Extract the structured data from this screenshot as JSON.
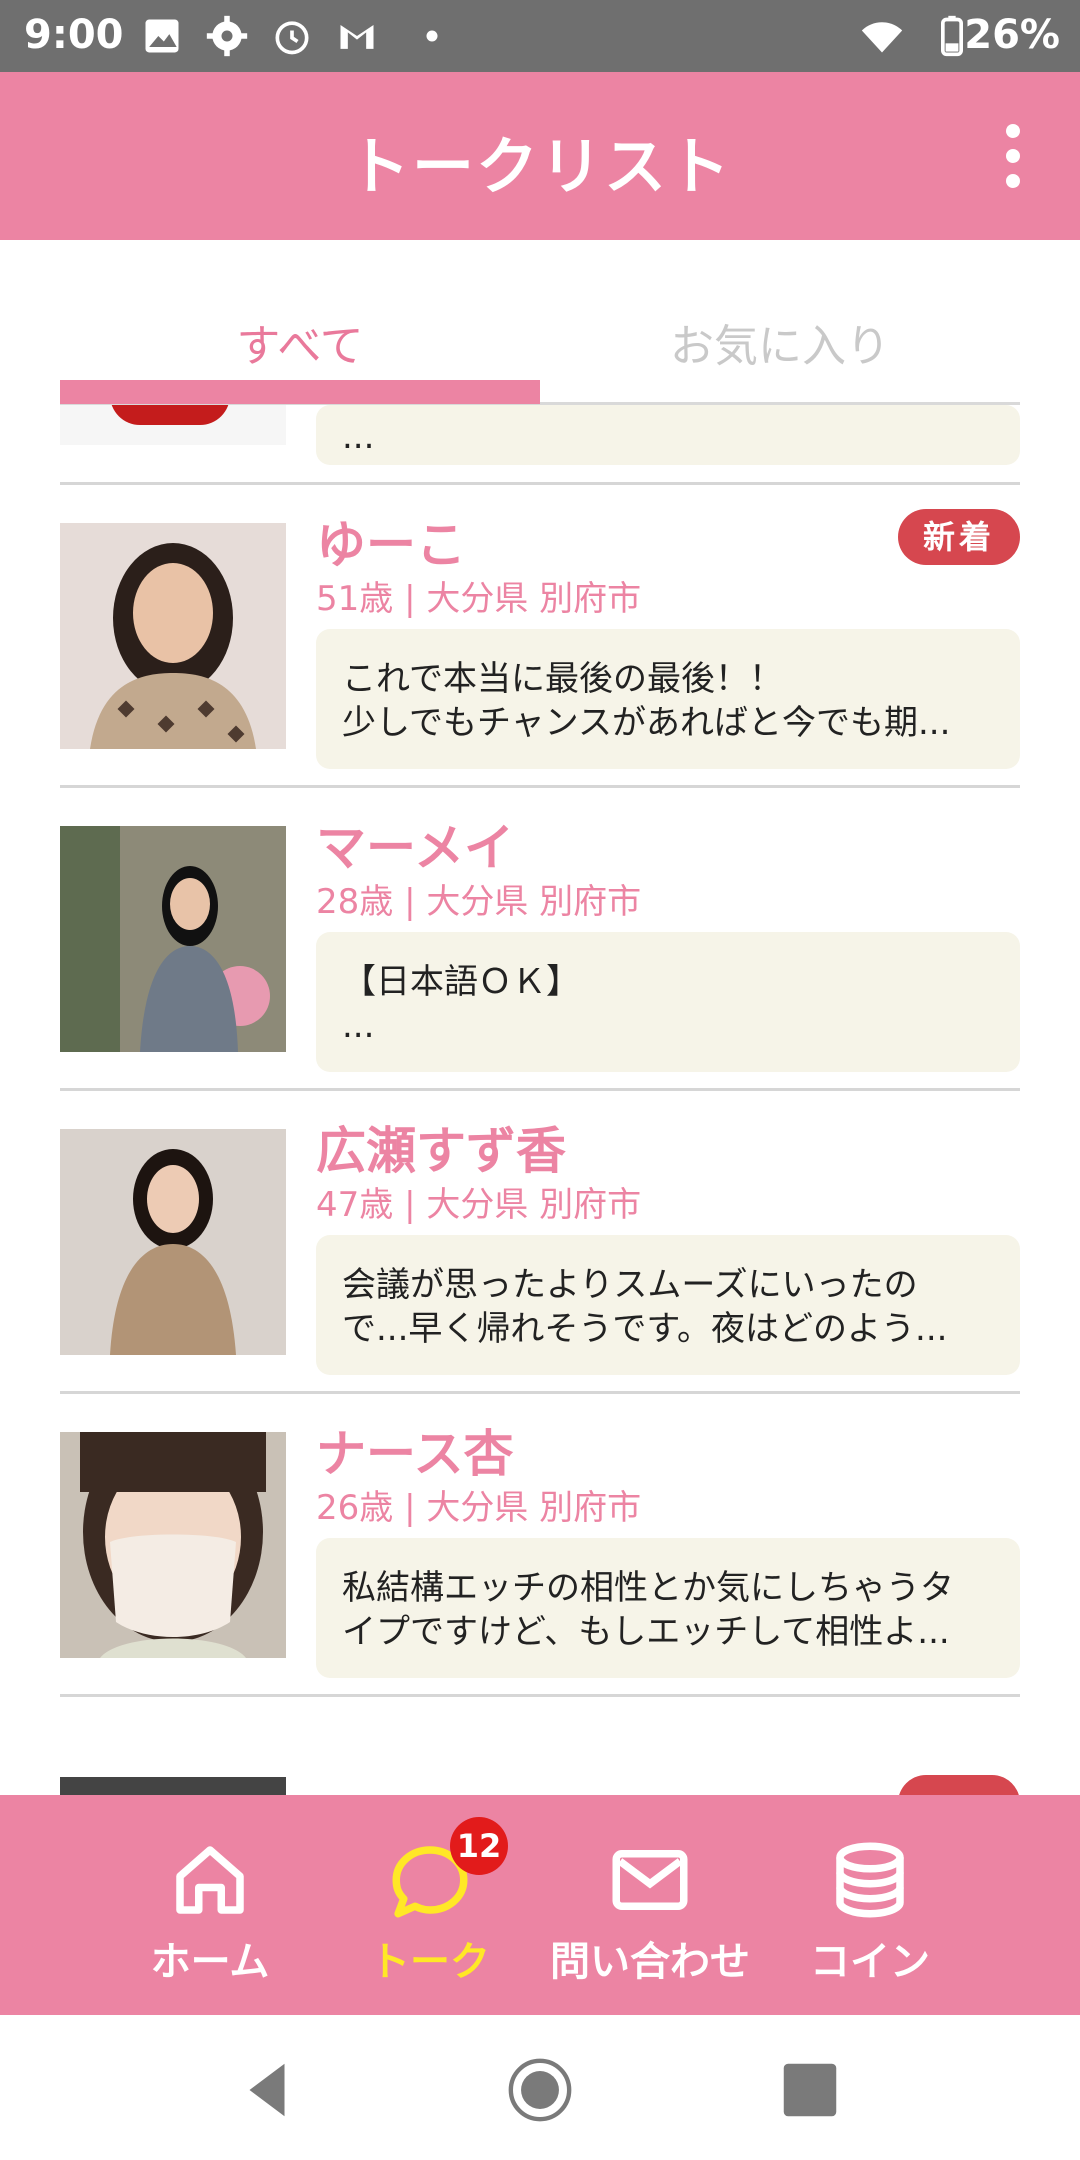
{
  "status_bar": {
    "time": "9:00",
    "battery": "26%"
  },
  "header": {
    "title": "トークリスト"
  },
  "tabs": [
    {
      "label": "すべて",
      "active": true
    },
    {
      "label": "お気に入り",
      "active": false
    }
  ],
  "partial_top_row": {
    "message_line": "..."
  },
  "conversations": [
    {
      "name": "ゆーこ",
      "meta": "51歳 | 大分県 別府市",
      "badge": "新着",
      "message_lines": [
        "これで本当に最後の最後！！",
        "少しでもチャンスがあればと今でも期..."
      ]
    },
    {
      "name": "マーメイ",
      "meta": "28歳 | 大分県 別府市",
      "badge": "",
      "message_lines": [
        "【日本語ＯＫ】",
        "..."
      ]
    },
    {
      "name": "広瀬すず香",
      "meta": "47歳 | 大分県 別府市",
      "badge": "",
      "message_lines": [
        "会議が思ったよりスムーズにいったの",
        "で...早く帰れそうです。夜はどのよう..."
      ]
    },
    {
      "name": "ナース杏",
      "meta": "26歳 | 大分県 別府市",
      "badge": "",
      "message_lines": [
        "私結構エッチの相性とか気にしちゃうタ",
        "イプですけど、もしエッチして相性よ..."
      ]
    }
  ],
  "bottom_nav": {
    "items": [
      {
        "label": "ホーム",
        "icon": "home-icon"
      },
      {
        "label": "トーク",
        "icon": "chat-icon",
        "badge": "12",
        "active": true
      },
      {
        "label": "問い合わせ",
        "icon": "mail-icon"
      },
      {
        "label": "コイン",
        "icon": "coins-icon"
      }
    ]
  },
  "colors": {
    "primary": "#ec84a3",
    "active_nav": "#ffe826",
    "badge": "#d6474f",
    "bubble": "#f6f4e8"
  }
}
